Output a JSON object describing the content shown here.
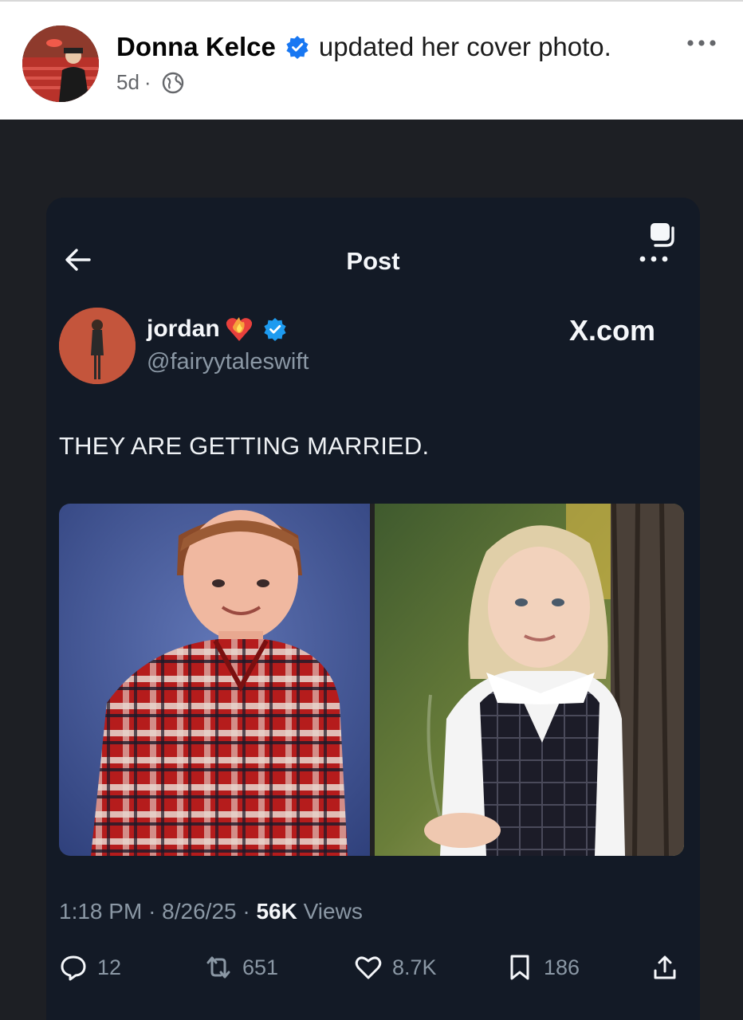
{
  "facebook": {
    "author_name": "Donna Kelce",
    "action_text": "updated her cover photo.",
    "time_ago": "5d",
    "separator": "·",
    "icons": {
      "verified": "verified-badge-icon",
      "audience": "globe-icon",
      "more": "more-options-icon"
    },
    "colors": {
      "verified": "#1877f2",
      "name": "#050505",
      "meta": "#65676b"
    }
  },
  "x_post": {
    "header_title": "Post",
    "icons": {
      "back": "back-arrow-icon",
      "grok": "grok-icon",
      "more": "more-options-icon",
      "heart": "heart-on-fire-emoji",
      "verified": "verified-badge-icon"
    },
    "author": {
      "display_name": "jordan",
      "handle": "@fairyytaleswift"
    },
    "watermark": "X.com",
    "text": "THEY ARE GETTING MARRIED.",
    "time": "1:18 PM",
    "date": "8/26/25",
    "views_count": "56K",
    "views_label": "Views",
    "separator": "·",
    "actions": {
      "replies": "12",
      "reposts": "651",
      "likes": "8.7K",
      "bookmarks": "186"
    },
    "colors": {
      "background": "#131a26",
      "text": "#f5f7fa",
      "secondary_text": "#8b98a5",
      "verified": "#1d9bf0"
    }
  }
}
